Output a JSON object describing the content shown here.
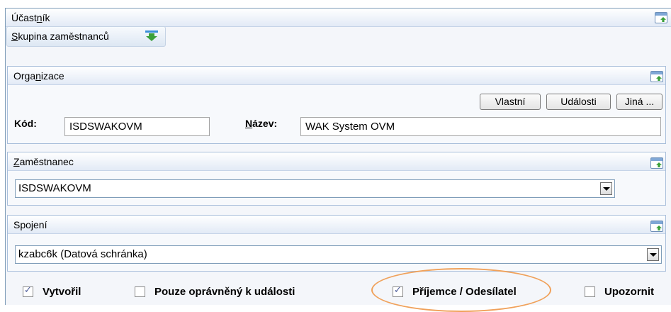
{
  "participant": {
    "title_pre": "Účast",
    "title_ul": "n",
    "title_post": "ík"
  },
  "group_button": {
    "label_ul": "S",
    "label_rest": "kupina zaměstnanců"
  },
  "organization": {
    "title_pre": "Orga",
    "title_ul": "n",
    "title_post": "izace",
    "buttons": [
      "Vlastní",
      "Události",
      "Jiná ..."
    ],
    "code_label": "Kód:",
    "code_value": "ISDSWAKOVM",
    "name_label_ul": "N",
    "name_label_rest": "ázev:",
    "name_value": "WAK System OVM"
  },
  "employee": {
    "title_ul": "Z",
    "title_rest": "aměstnanec",
    "selected": "ISDSWAKOVM"
  },
  "connection": {
    "title": "Spojení",
    "selected": "kzabc6k (Datová schránka)"
  },
  "checkboxes": [
    {
      "label": "Vytvořil",
      "checked": true
    },
    {
      "label": "Pouze oprávněný k události",
      "checked": false
    },
    {
      "label": "Příjemce / Odesílatel",
      "checked": true
    },
    {
      "label": "Upozornit",
      "checked": false
    }
  ],
  "colors": {
    "highlight_oval": "#f0a15a",
    "panel_border": "#a9bfdb"
  }
}
